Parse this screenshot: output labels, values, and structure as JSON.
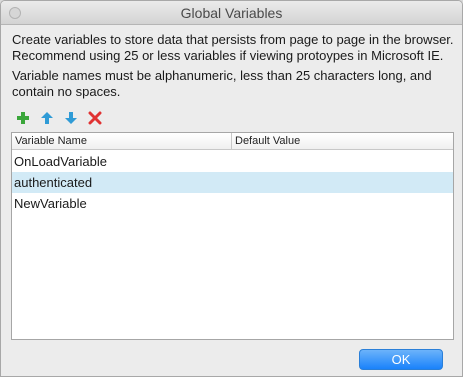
{
  "window": {
    "title": "Global Variables"
  },
  "description": {
    "line1": "Create variables to store data that persists from page to page in the browser. Recommend using 25 or less variables if viewing protoypes in Microsoft IE.",
    "line2": "Variable names must be alphanumeric, less than 25 characters long, and contain no spaces."
  },
  "toolbar": {
    "add_icon": "plus-icon",
    "move_up_icon": "arrow-up-icon",
    "move_down_icon": "arrow-down-icon",
    "delete_icon": "x-icon",
    "colors": {
      "add": "#3aa63a",
      "move": "#2f9bd6",
      "delete": "#e03232"
    }
  },
  "table": {
    "columns": [
      "Variable Name",
      "Default Value"
    ],
    "rows": [
      {
        "name": "OnLoadVariable",
        "default": "",
        "selected": false
      },
      {
        "name": "authenticated",
        "default": "",
        "selected": true
      },
      {
        "name": "NewVariable",
        "default": "",
        "selected": false
      }
    ],
    "selected_color": "#d2eaf6"
  },
  "buttons": {
    "ok_label": "OK",
    "accent": "#1a82fb"
  }
}
